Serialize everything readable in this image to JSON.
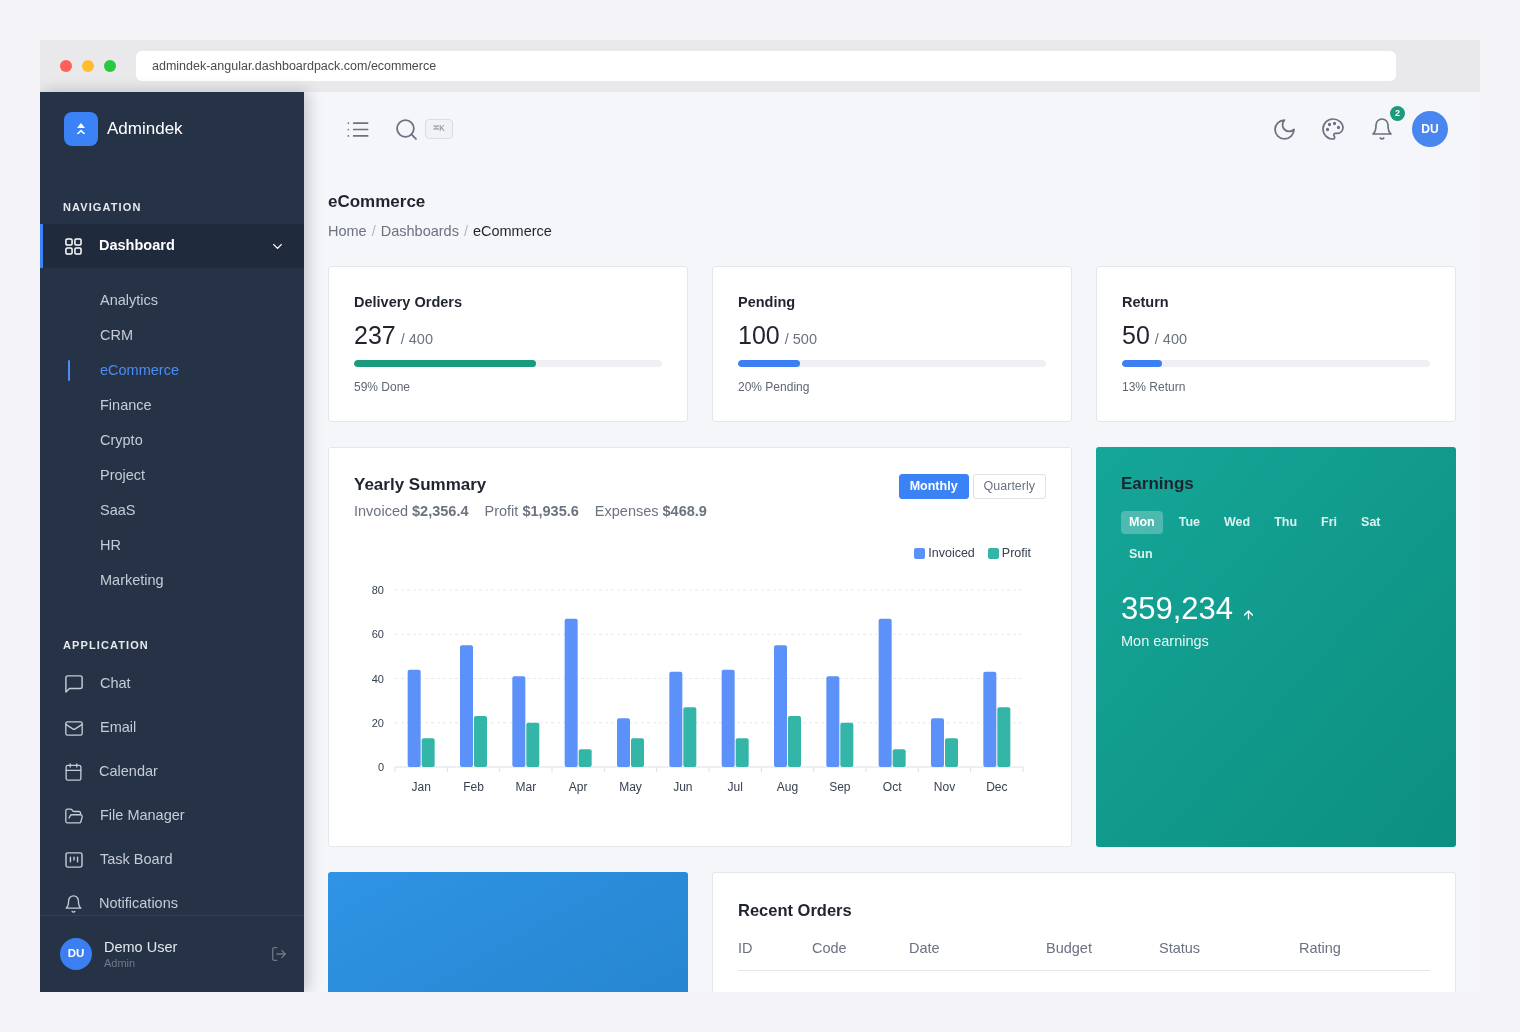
{
  "browser": {
    "url": "admindek-angular.dashboardpack.com/ecommerce"
  },
  "sidebar": {
    "brand": "Admindek",
    "sections": [
      {
        "heading": "NAVIGATION",
        "items": [
          {
            "label": "Dashboard",
            "selected": true,
            "expanded": true,
            "children": [
              {
                "label": "Analytics",
                "selected": false
              },
              {
                "label": "CRM",
                "selected": false
              },
              {
                "label": "eCommerce",
                "selected": true
              },
              {
                "label": "Finance",
                "selected": false
              },
              {
                "label": "Crypto",
                "selected": false
              },
              {
                "label": "Project",
                "selected": false
              },
              {
                "label": "SaaS",
                "selected": false
              },
              {
                "label": "HR",
                "selected": false
              },
              {
                "label": "Marketing",
                "selected": false
              }
            ]
          }
        ]
      },
      {
        "heading": "APPLICATION",
        "items": [
          {
            "label": "Chat",
            "selected": false
          },
          {
            "label": "Email",
            "selected": false
          },
          {
            "label": "Calendar",
            "selected": false
          },
          {
            "label": "File Manager",
            "selected": false
          },
          {
            "label": "Task Board",
            "selected": false
          },
          {
            "label": "Notifications",
            "selected": false
          }
        ]
      }
    ],
    "user": {
      "initials": "DU",
      "name": "Demo User",
      "role": "Admin"
    }
  },
  "header": {
    "shortcut": "⌘K",
    "notifications": "2",
    "avatar": "DU"
  },
  "page": {
    "title": "eCommerce",
    "breadcrumb": {
      "separator": "/",
      "items": [
        {
          "label": "Home",
          "current": false
        },
        {
          "label": "Dashboards",
          "current": false
        },
        {
          "label": "eCommerce",
          "current": true
        }
      ]
    }
  },
  "stats": [
    {
      "title": "Delivery Orders",
      "value": "237",
      "total": "/ 400",
      "level": 0.59,
      "color": "#1a9b7e",
      "caption": "59% Done"
    },
    {
      "title": "Pending",
      "value": "100",
      "total": "/ 500",
      "level": 0.2,
      "color": "#3b7ff2",
      "caption": "20% Pending"
    },
    {
      "title": "Return",
      "value": "50",
      "total": "/ 400",
      "level": 0.13,
      "color": "#3b7ff2",
      "caption": "13% Return"
    }
  ],
  "yearly_summary": {
    "title": "Yearly Summary",
    "totals": [
      "Invoiced **$2,356.4**",
      "Profit **$1,935.6**",
      "Expenses **$468.9**"
    ],
    "periods": [
      {
        "label": "Monthly",
        "selected": true
      },
      {
        "label": "Quarterly",
        "selected": false
      }
    ],
    "chart_data": {
      "type": "bar",
      "categories": [
        "Jan",
        "Feb",
        "Mar",
        "Apr",
        "May",
        "Jun",
        "Jul",
        "Aug",
        "Sep",
        "Oct",
        "Nov",
        "Dec"
      ],
      "series": [
        {
          "name": "Invoiced",
          "color": "#5b91f8",
          "values": [
            44,
            55,
            41,
            67,
            22,
            43,
            44,
            55,
            41,
            67,
            22,
            43
          ]
        },
        {
          "name": "Profit",
          "color": "#33b5a7",
          "values": [
            13,
            23,
            20,
            8,
            13,
            27,
            13,
            23,
            20,
            8,
            13,
            27
          ]
        }
      ],
      "ylim": [
        0,
        80
      ],
      "yticks": [
        0,
        20,
        40,
        60,
        80
      ],
      "grid": true,
      "legend": true
    }
  },
  "earnings": {
    "title": "Earnings",
    "days": [
      {
        "label": "Mon",
        "selected": true
      },
      {
        "label": "Tue",
        "selected": false
      },
      {
        "label": "Wed",
        "selected": false
      },
      {
        "label": "Thu",
        "selected": false
      },
      {
        "label": "Fri",
        "selected": false
      },
      {
        "label": "Sat",
        "selected": false
      },
      {
        "label": "Sun",
        "selected": false
      }
    ],
    "value": "359,234",
    "caption": "Mon earnings"
  },
  "recent_orders": {
    "title": "Recent Orders",
    "columns": [
      "ID",
      "Code",
      "Date",
      "Budget",
      "Status",
      "Rating"
    ]
  }
}
